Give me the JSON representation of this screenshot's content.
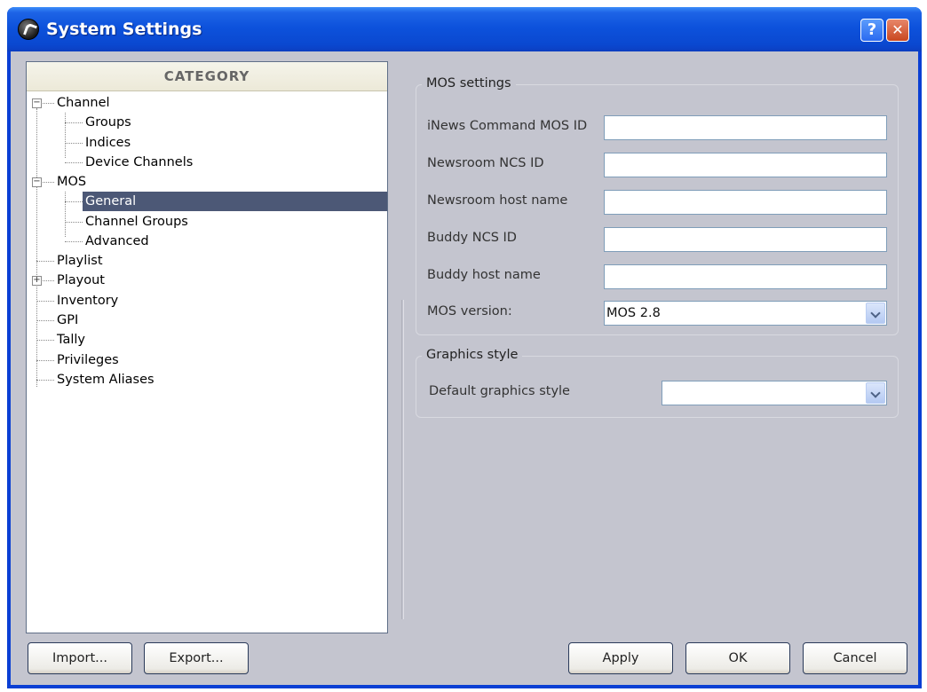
{
  "window": {
    "title": "System Settings"
  },
  "titlebar": {
    "help_glyph": "?",
    "close_glyph": "✕"
  },
  "category": {
    "header": "CATEGORY",
    "items": [
      {
        "label": "Channel",
        "expander": "−"
      },
      {
        "label": "Groups"
      },
      {
        "label": "Indices"
      },
      {
        "label": "Device Channels"
      },
      {
        "label": "MOS",
        "expander": "−"
      },
      {
        "label": "General",
        "selected": true
      },
      {
        "label": "Channel Groups"
      },
      {
        "label": "Advanced"
      },
      {
        "label": "Playlist"
      },
      {
        "label": "Playout",
        "expander": "+"
      },
      {
        "label": "Inventory"
      },
      {
        "label": "GPI"
      },
      {
        "label": "Tally"
      },
      {
        "label": "Privileges"
      },
      {
        "label": "System Aliases"
      }
    ]
  },
  "mos_settings": {
    "legend": "MOS settings",
    "fields": [
      {
        "label": "iNews Command MOS ID",
        "value": ""
      },
      {
        "label": "Newsroom NCS ID",
        "value": ""
      },
      {
        "label": "Newsroom host name",
        "value": ""
      },
      {
        "label": "Buddy NCS ID",
        "value": ""
      },
      {
        "label": "Buddy host name",
        "value": ""
      }
    ],
    "version_label": "MOS version:",
    "version_value": "MOS 2.8"
  },
  "graphics_style": {
    "legend": "Graphics style",
    "default_label": "Default graphics style",
    "default_value": ""
  },
  "buttons": {
    "import": "Import...",
    "export": "Export...",
    "apply": "Apply",
    "ok": "OK",
    "cancel": "Cancel"
  }
}
